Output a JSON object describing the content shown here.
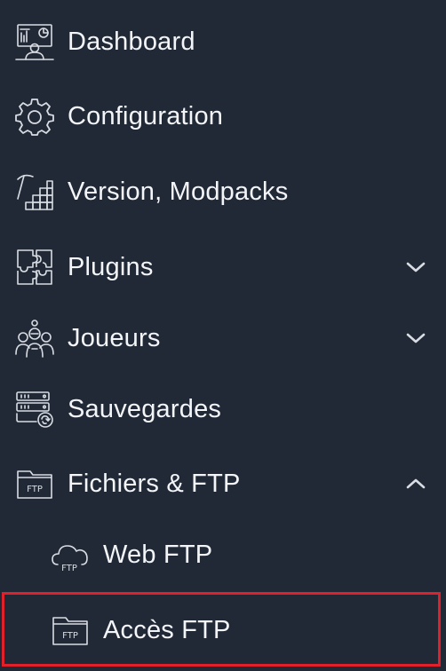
{
  "colors": {
    "background": "#212937",
    "text": "#f3f5f8",
    "icon": "#d9dde3",
    "highlight": "#e0202a"
  },
  "menu": [
    {
      "label": "Dashboard",
      "icon": "dashboard-icon"
    },
    {
      "label": "Configuration",
      "icon": "gear-icon"
    },
    {
      "label": "Version, Modpacks",
      "icon": "pickaxe-blocks-icon"
    },
    {
      "label": "Plugins",
      "icon": "puzzle-icon",
      "chevron": "down"
    },
    {
      "label": "Joueurs",
      "icon": "players-icon",
      "chevron": "down"
    },
    {
      "label": "Sauvegardes",
      "icon": "server-backup-icon"
    },
    {
      "label": "Fichiers & FTP",
      "icon": "ftp-folder-icon",
      "chevron": "up",
      "icon_text": "FTP",
      "children": [
        {
          "label": "Web FTP",
          "icon": "cloud-ftp-icon",
          "icon_text": "FTP"
        },
        {
          "label": "Accès FTP",
          "icon": "ftp-folder-icon",
          "icon_text": "FTP",
          "highlighted": true
        }
      ]
    }
  ]
}
